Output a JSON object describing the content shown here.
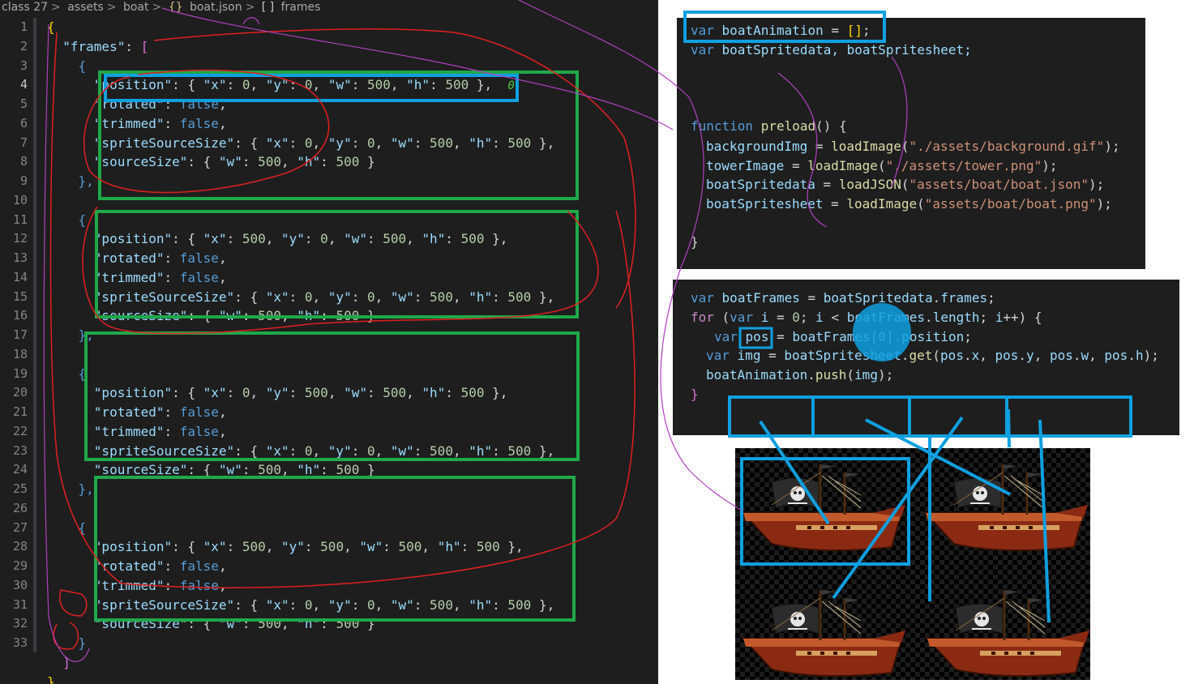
{
  "breadcrumb": {
    "items": [
      "class 27",
      "assets",
      "boat",
      "boat.json",
      "frames"
    ],
    "separator": ">",
    "json_icon": "{}",
    "array_icon": "[ ]"
  },
  "editor": {
    "line_numbers": [
      "1",
      "2",
      "3",
      "4",
      "5",
      "6",
      "7",
      "8",
      "9",
      "10",
      "11",
      "12",
      "13",
      "14",
      "15",
      "16",
      "17",
      "18",
      "19",
      "20",
      "21",
      "22",
      "23",
      "24",
      "25",
      "26",
      "27",
      "28",
      "29",
      "30",
      "31",
      "32",
      "33"
    ],
    "frames_key": "\"frames\"",
    "position_key": "\"position\"",
    "rotated_key": "\"rotated\"",
    "trimmed_key": "\"trimmed\"",
    "sss_key": "\"spriteSourceSize\"",
    "source_key": "\"sourceSize\"",
    "false_value": "false",
    "codelens_value": "0",
    "frames": [
      {
        "x": "0",
        "y": "0",
        "w": "500",
        "h": "500"
      },
      {
        "x": "500",
        "y": "0",
        "w": "500",
        "h": "500"
      },
      {
        "x": "0",
        "y": "500",
        "w": "500",
        "h": "500"
      },
      {
        "x": "500",
        "y": "500",
        "w": "500",
        "h": "500"
      }
    ],
    "sss": {
      "x": "0",
      "y": "0",
      "w": "500",
      "h": "500"
    },
    "source": {
      "w": "500",
      "h": "500"
    }
  },
  "panel_top": {
    "line1": [
      "var",
      " ",
      "boatAnimation",
      " = ",
      "[]",
      ";"
    ],
    "line2": [
      "var",
      " boatSpritedata, boatSpritesheet;"
    ],
    "line3": [
      "function",
      " ",
      "preload",
      "() {"
    ],
    "line4": [
      "backgroundImg",
      " = ",
      "loadImage",
      "(",
      "\"./assets/background.gif\"",
      ");"
    ],
    "line5": [
      "towerImage",
      " = ",
      "loadImage",
      "(",
      "\"./assets/tower.png\"",
      ");"
    ],
    "line6": [
      "boatSpritedata",
      " = ",
      "loadJSON",
      "(",
      "\"assets/boat/boat.json\"",
      ");"
    ],
    "line7": [
      "boatSpritesheet",
      " = ",
      "loadImage",
      "(",
      "\"assets/boat/boat.png\"",
      ");"
    ],
    "line8": "}"
  },
  "panel_bottom": {
    "line1": [
      "var",
      " ",
      "boatFrames",
      " = ",
      "boatSpritedata",
      ".",
      "frames",
      ";"
    ],
    "line2": [
      "for",
      " (",
      "var",
      " ",
      "i",
      " = ",
      "0",
      "; ",
      "i",
      " < ",
      "boatFrames",
      ".",
      "length",
      "; ",
      "i",
      "++) {"
    ],
    "line3": [
      "var",
      " ",
      "pos",
      " = ",
      "boatFrames",
      "[",
      "0",
      "].",
      "position",
      ";"
    ],
    "line4": [
      "var",
      " ",
      "img",
      " = ",
      "boatSpritesheet",
      ".",
      "get",
      "(",
      "pos",
      ".",
      "x",
      ", ",
      "pos",
      ".",
      "y",
      ", ",
      "pos",
      ".",
      "w",
      ", ",
      "pos",
      ".",
      "h",
      ");"
    ],
    "line5": [
      "boatAnimation",
      ".",
      "push",
      "(",
      "img",
      ");"
    ],
    "line6": "}"
  },
  "colors": {
    "editor_bg": "#1e1e1e",
    "annotation_blue": "#0fa0e0",
    "annotation_green": "#1fa84a",
    "annotation_red": "#e02020",
    "annotation_purple": "#b040c0"
  },
  "icons": [
    "pirate-ship-icon",
    "skull-flag-icon"
  ]
}
